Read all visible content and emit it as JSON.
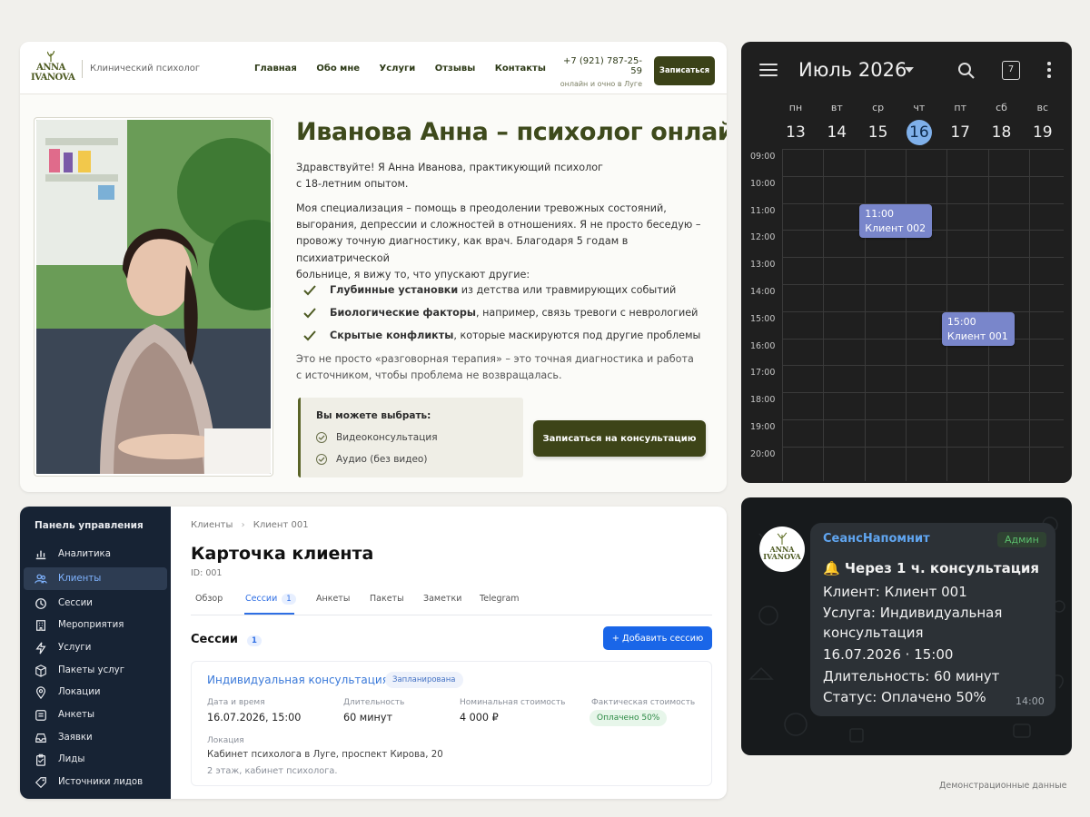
{
  "website": {
    "logo": {
      "line1": "ANNA",
      "line2": "IVANOVA"
    },
    "subtitle": "Клинический психолог",
    "nav": [
      "Главная",
      "Обо мне",
      "Услуги",
      "Отзывы",
      "Контакты"
    ],
    "phone": "+7 (921) 787-25-59",
    "phone_note": "онлайн и очно в Луге",
    "nav_button": "Записаться",
    "heading": "Иванова Анна – психолог онлайн",
    "intro_1": "Здравствуйте! Я Анна Иванова, практикующий психолог",
    "intro_2": "с 18-летним опытом.",
    "desc_1": "Моя специализация – помощь в преодолении тревожных состояний,",
    "desc_2": "выгорания, депрессии и сложностей в отношениях. Я не просто беседую –",
    "desc_3": "провожу точную диагностику, как врач. Благодаря 5 годам в психиатрической",
    "desc_4": "больнице, я вижу то, что упускают другие:",
    "bullets": [
      {
        "bold": "Глубинные установки",
        "rest": " из детства или травмирующих событий"
      },
      {
        "bold": "Биологические факторы",
        "rest": ", например, связь тревоги с неврологией"
      },
      {
        "bold": "Скрытые конфликты",
        "rest": ", которые маскируются под другие проблемы"
      }
    ],
    "note_1": "Это не просто «разговорная терапия» – это точная диагностика и работа",
    "note_2": "с источником, чтобы проблема не возвращалась.",
    "choose_title": "Вы можете выбрать:",
    "choose_options": [
      "Видеоконсультация",
      "Аудио (без видео)"
    ],
    "cta": "Записаться на консультацию"
  },
  "calendar": {
    "month": "Июль 2026",
    "today_icon": "7",
    "days": [
      {
        "name": "пн",
        "num": "13"
      },
      {
        "name": "вт",
        "num": "14"
      },
      {
        "name": "ср",
        "num": "15"
      },
      {
        "name": "чт",
        "num": "16"
      },
      {
        "name": "пт",
        "num": "17"
      },
      {
        "name": "сб",
        "num": "18"
      },
      {
        "name": "вс",
        "num": "19"
      }
    ],
    "today_index": 3,
    "hours": [
      "09:00",
      "10:00",
      "11:00",
      "12:00",
      "13:00",
      "14:00",
      "15:00",
      "16:00",
      "17:00",
      "18:00",
      "19:00",
      "20:00"
    ],
    "events": [
      {
        "time": "11:00",
        "title": "Клиент 002"
      },
      {
        "time": "15:00",
        "title": "Клиент 001"
      }
    ],
    "event_color": "#7986cb"
  },
  "admin": {
    "sidebar_title": "Панель управления",
    "sidebar_items": [
      {
        "label": "Аналитика",
        "icon": "chart-icon"
      },
      {
        "label": "Клиенты",
        "icon": "users-icon"
      },
      {
        "label": "Сессии",
        "icon": "clock-icon"
      },
      {
        "label": "Мероприятия",
        "icon": "building-icon"
      },
      {
        "label": "Услуги",
        "icon": "bolt-icon"
      },
      {
        "label": "Пакеты услуг",
        "icon": "box-icon"
      },
      {
        "label": "Локации",
        "icon": "pin-icon"
      },
      {
        "label": "Анкеты",
        "icon": "list-icon"
      },
      {
        "label": "Заявки",
        "icon": "inbox-icon"
      },
      {
        "label": "Лиды",
        "icon": "clipboard-icon"
      },
      {
        "label": "Источники лидов",
        "icon": "tag-icon"
      }
    ],
    "active_item": "Клиенты",
    "breadcrumb": [
      "Клиенты",
      "Клиент 001"
    ],
    "title": "Карточка клиента",
    "id": "ID: 001",
    "tabs": [
      "Обзор",
      "Сессии",
      "Анкеты",
      "Пакеты",
      "Заметки",
      "Telegram"
    ],
    "sessions_badge": "1",
    "section_title": "Сессии",
    "section_badge": "1",
    "add_button": "+ Добавить сессию",
    "session": {
      "name": "Индивидуальная консультация",
      "status": "Запланирована",
      "date_label": "Дата и время",
      "date_value": "16.07.2026, 15:00",
      "duration_label": "Длительность",
      "duration_value": "60 минут",
      "nominal_label": "Номинальная стоимость",
      "nominal_value": "4 000 ₽",
      "actual_label": "Фактическая стоимость",
      "actual_value": "Оплачено 50%",
      "location_label": "Локация",
      "location_value": "Кабинет психолога в Луге, проспект Кирова, 20",
      "location_note": "2 этаж, кабинет психолога."
    }
  },
  "telegram": {
    "bot_name": "СеансНапомнит",
    "role": "Админ",
    "headline": "🔔 Через 1 ч. консультация",
    "lines": [
      "Клиент: Клиент 001",
      "Услуга: Индивидуальная",
      "консультация",
      "16.07.2026 · 15:00",
      "Длительность: 60 минут",
      "Статус: Оплачено 50%"
    ],
    "time": "14:00"
  },
  "footer": "Демонстрационные данные"
}
